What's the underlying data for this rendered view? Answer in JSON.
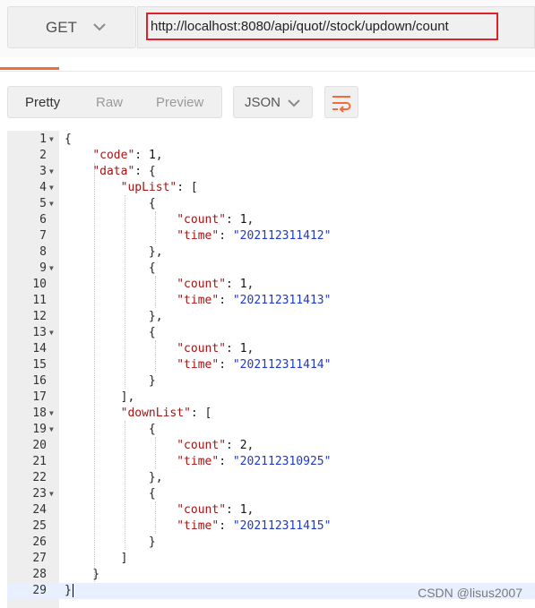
{
  "request": {
    "method": "GET",
    "url": "http://localhost:8080/api/quot//stock/updown/count"
  },
  "response_toolbar": {
    "views": [
      "Pretty",
      "Raw",
      "Preview"
    ],
    "selected_view": "Pretty",
    "format": "JSON",
    "wrap_icon": "wrap-lines-icon"
  },
  "editor": {
    "lines": [
      {
        "n": "1",
        "fold": true,
        "tokens": [
          [
            "p",
            "{"
          ]
        ]
      },
      {
        "n": "2",
        "fold": false,
        "tokens": [
          [
            "p",
            "    "
          ],
          [
            "k",
            "\"code\""
          ],
          [
            "p",
            ": "
          ],
          [
            "n",
            "1"
          ],
          [
            "p",
            ","
          ]
        ]
      },
      {
        "n": "3",
        "fold": true,
        "tokens": [
          [
            "p",
            "    "
          ],
          [
            "k",
            "\"data\""
          ],
          [
            "p",
            ": {"
          ]
        ]
      },
      {
        "n": "4",
        "fold": true,
        "tokens": [
          [
            "p",
            "        "
          ],
          [
            "k",
            "\"upList\""
          ],
          [
            "p",
            ": ["
          ]
        ]
      },
      {
        "n": "5",
        "fold": true,
        "tokens": [
          [
            "p",
            "            {"
          ]
        ]
      },
      {
        "n": "6",
        "fold": false,
        "tokens": [
          [
            "p",
            "                "
          ],
          [
            "k",
            "\"count\""
          ],
          [
            "p",
            ": "
          ],
          [
            "n",
            "1"
          ],
          [
            "p",
            ","
          ]
        ]
      },
      {
        "n": "7",
        "fold": false,
        "tokens": [
          [
            "p",
            "                "
          ],
          [
            "k",
            "\"time\""
          ],
          [
            "p",
            ": "
          ],
          [
            "s",
            "\"202112311412\""
          ]
        ]
      },
      {
        "n": "8",
        "fold": false,
        "tokens": [
          [
            "p",
            "            },"
          ]
        ]
      },
      {
        "n": "9",
        "fold": true,
        "tokens": [
          [
            "p",
            "            {"
          ]
        ]
      },
      {
        "n": "10",
        "fold": false,
        "tokens": [
          [
            "p",
            "                "
          ],
          [
            "k",
            "\"count\""
          ],
          [
            "p",
            ": "
          ],
          [
            "n",
            "1"
          ],
          [
            "p",
            ","
          ]
        ]
      },
      {
        "n": "11",
        "fold": false,
        "tokens": [
          [
            "p",
            "                "
          ],
          [
            "k",
            "\"time\""
          ],
          [
            "p",
            ": "
          ],
          [
            "s",
            "\"202112311413\""
          ]
        ]
      },
      {
        "n": "12",
        "fold": false,
        "tokens": [
          [
            "p",
            "            },"
          ]
        ]
      },
      {
        "n": "13",
        "fold": true,
        "tokens": [
          [
            "p",
            "            {"
          ]
        ]
      },
      {
        "n": "14",
        "fold": false,
        "tokens": [
          [
            "p",
            "                "
          ],
          [
            "k",
            "\"count\""
          ],
          [
            "p",
            ": "
          ],
          [
            "n",
            "1"
          ],
          [
            "p",
            ","
          ]
        ]
      },
      {
        "n": "15",
        "fold": false,
        "tokens": [
          [
            "p",
            "                "
          ],
          [
            "k",
            "\"time\""
          ],
          [
            "p",
            ": "
          ],
          [
            "s",
            "\"202112311414\""
          ]
        ]
      },
      {
        "n": "16",
        "fold": false,
        "tokens": [
          [
            "p",
            "            }"
          ]
        ]
      },
      {
        "n": "17",
        "fold": false,
        "tokens": [
          [
            "p",
            "        ],"
          ]
        ]
      },
      {
        "n": "18",
        "fold": true,
        "tokens": [
          [
            "p",
            "        "
          ],
          [
            "k",
            "\"downList\""
          ],
          [
            "p",
            ": ["
          ]
        ]
      },
      {
        "n": "19",
        "fold": true,
        "tokens": [
          [
            "p",
            "            {"
          ]
        ]
      },
      {
        "n": "20",
        "fold": false,
        "tokens": [
          [
            "p",
            "                "
          ],
          [
            "k",
            "\"count\""
          ],
          [
            "p",
            ": "
          ],
          [
            "n",
            "2"
          ],
          [
            "p",
            ","
          ]
        ]
      },
      {
        "n": "21",
        "fold": false,
        "tokens": [
          [
            "p",
            "                "
          ],
          [
            "k",
            "\"time\""
          ],
          [
            "p",
            ": "
          ],
          [
            "s",
            "\"202112310925\""
          ]
        ]
      },
      {
        "n": "22",
        "fold": false,
        "tokens": [
          [
            "p",
            "            },"
          ]
        ]
      },
      {
        "n": "23",
        "fold": true,
        "tokens": [
          [
            "p",
            "            {"
          ]
        ]
      },
      {
        "n": "24",
        "fold": false,
        "tokens": [
          [
            "p",
            "                "
          ],
          [
            "k",
            "\"count\""
          ],
          [
            "p",
            ": "
          ],
          [
            "n",
            "1"
          ],
          [
            "p",
            ","
          ]
        ]
      },
      {
        "n": "25",
        "fold": false,
        "tokens": [
          [
            "p",
            "                "
          ],
          [
            "k",
            "\"time\""
          ],
          [
            "p",
            ": "
          ],
          [
            "s",
            "\"202112311415\""
          ]
        ]
      },
      {
        "n": "26",
        "fold": false,
        "tokens": [
          [
            "p",
            "            }"
          ]
        ]
      },
      {
        "n": "27",
        "fold": false,
        "tokens": [
          [
            "p",
            "        ]"
          ]
        ]
      },
      {
        "n": "28",
        "fold": false,
        "tokens": [
          [
            "p",
            "    }"
          ]
        ]
      },
      {
        "n": "29",
        "fold": false,
        "tokens": [
          [
            "p",
            "}"
          ]
        ]
      }
    ]
  },
  "watermark": "CSDN @lisus2007",
  "colors": {
    "key": "#a31515",
    "string": "#1f39c4",
    "highlight_border": "#e0202a",
    "accent": "#f26b3a"
  }
}
